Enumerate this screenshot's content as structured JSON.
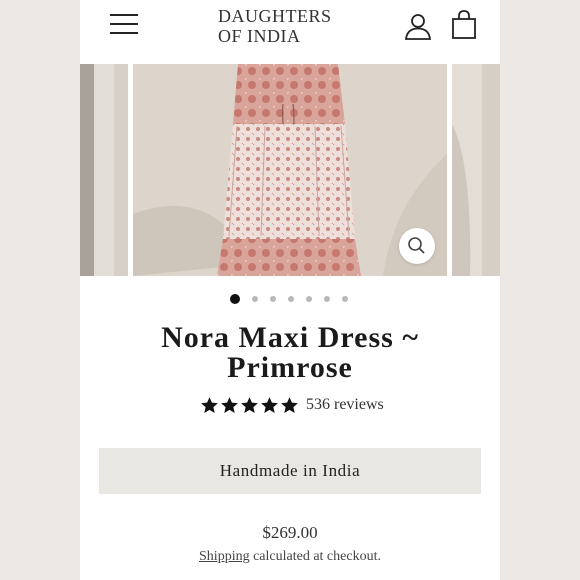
{
  "header": {
    "logo_line1": "DAUGHTERS",
    "logo_line2": "OF INDIA",
    "menu_icon": "hamburger-menu-icon",
    "account_icon": "user-account-icon",
    "cart_icon": "shopping-bag-icon"
  },
  "gallery": {
    "slides": [
      "dress-photo-left",
      "dress-photo-main",
      "dress-photo-right"
    ],
    "zoom_icon": "magnifier-icon",
    "page_count": 7,
    "active_index": 0
  },
  "product": {
    "title": "Nora Maxi Dress ~ Primrose",
    "rating_stars": 5,
    "review_count": "536 reviews",
    "badge": "Handmade in India",
    "price": "$269.00",
    "shipping_link": "Shipping",
    "shipping_rest": " calculated at checkout."
  },
  "colors": {
    "text": "#222222",
    "badge_bg": "#e9e7e2",
    "dot_active": "#111111",
    "dot_inactive": "#b9b9b9",
    "dress_pink": "#c98276"
  }
}
